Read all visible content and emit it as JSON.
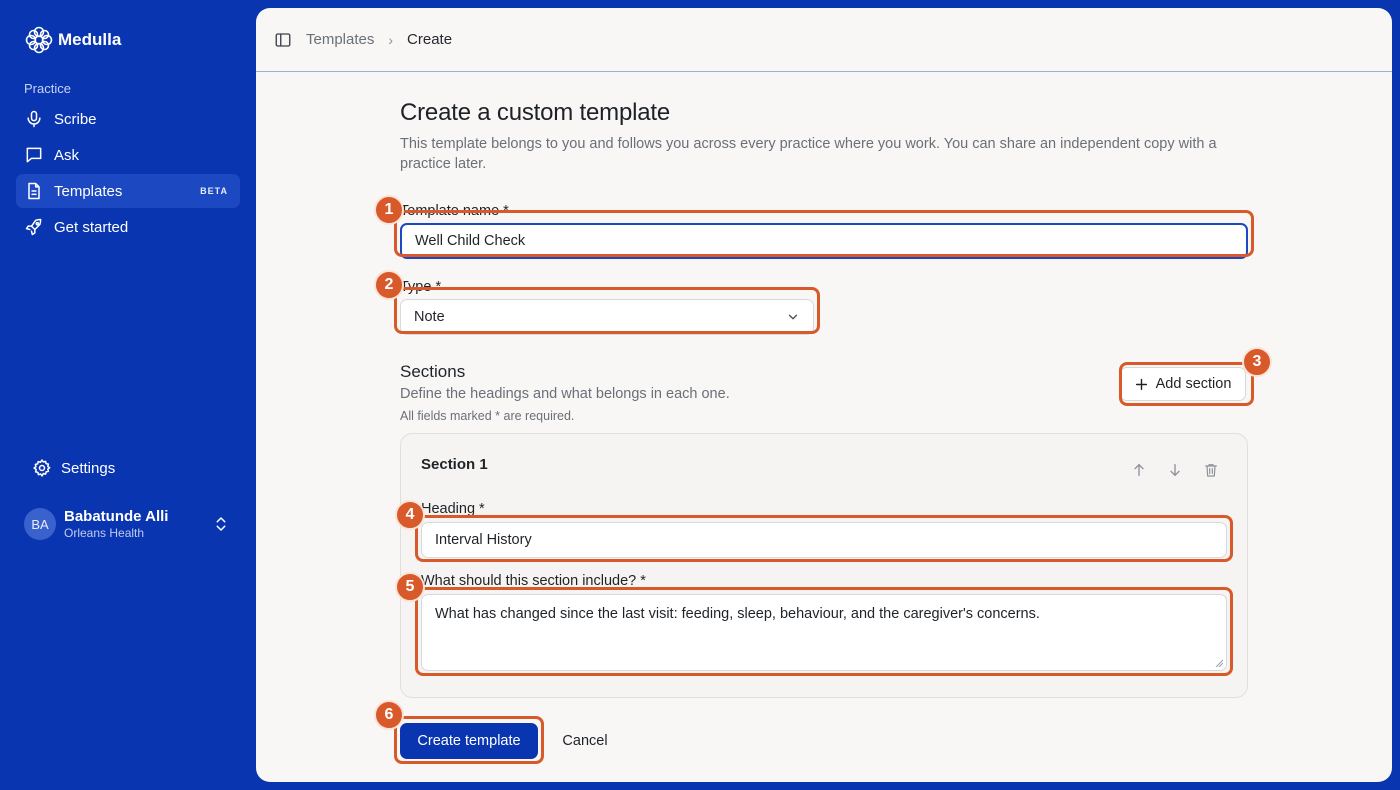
{
  "app": {
    "name": "Medulla"
  },
  "sidebar": {
    "section_label": "Practice",
    "items": [
      {
        "label": "Scribe",
        "icon": "microphone-icon"
      },
      {
        "label": "Ask",
        "icon": "chat-bubble-icon"
      },
      {
        "label": "Templates",
        "icon": "document-icon",
        "badge": "BETA",
        "active": true
      },
      {
        "label": "Get started",
        "icon": "rocket-icon"
      }
    ],
    "settings_label": "Settings",
    "user": {
      "initials": "BA",
      "name": "Babatunde Alli",
      "org": "Orleans Health"
    }
  },
  "breadcrumb": {
    "parent": "Templates",
    "separator": "›",
    "current": "Create"
  },
  "form": {
    "title": "Create a custom template",
    "subtitle": "This template belongs to you and follows you across every practice where you work. You can share an independent copy with a practice later.",
    "name_label": "Template name *",
    "name_value": "Well Child Check",
    "type_label": "Type *",
    "type_value": "Note",
    "sections_title": "Sections",
    "sections_desc": "Define the headings and what belongs in each one.",
    "sections_note": "All fields marked * are required.",
    "add_section_label": "Add section",
    "section_card": {
      "title": "Section 1",
      "heading_label": "Heading *",
      "heading_value": "Interval History",
      "include_label": "What should this section include? *",
      "include_value": "What has changed since the last visit: feeding, sleep, behaviour, and the caregiver's concerns."
    },
    "create_label": "Create template",
    "cancel_label": "Cancel"
  },
  "annotations": [
    "1",
    "2",
    "3",
    "4",
    "5",
    "6"
  ],
  "colors": {
    "brand": "#0a35b0",
    "panel": "#f8f7f5",
    "annotation": "#d85a2b"
  }
}
